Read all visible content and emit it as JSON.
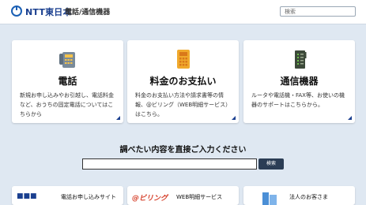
{
  "header": {
    "brand": "NTT東日本",
    "sub": "電話/通信機器",
    "search_placeholder": "検索"
  },
  "cards": [
    {
      "title": "電話",
      "desc": "新規お申し込みやお引越し、電話料金など、おうちの固定電話についてはこちらから",
      "icon": "phone-icon"
    },
    {
      "title": "料金のお支払い",
      "desc": "料金のお支払い方法や請求書等の情報、@ビリング（WEB明細サービス）はこちら。",
      "icon": "calculator-icon"
    },
    {
      "title": "通信機器",
      "desc": "ルータや電話機・FAX等、お使いの機器のサポートはこちらから。",
      "icon": "router-icon"
    }
  ],
  "search_section": {
    "prompt": "調べたい内容を直接ご入力ください",
    "button": "検索"
  },
  "banners": [
    {
      "logo": "■■■",
      "label": "電話お申し込みサイト"
    },
    {
      "logo": "@ビリング",
      "label": "WEB明細サービス"
    },
    {
      "logo": "",
      "label": "法人のお客さま"
    }
  ],
  "colors": {
    "accent": "#1a3f8f",
    "background": "#dfe8f2"
  }
}
